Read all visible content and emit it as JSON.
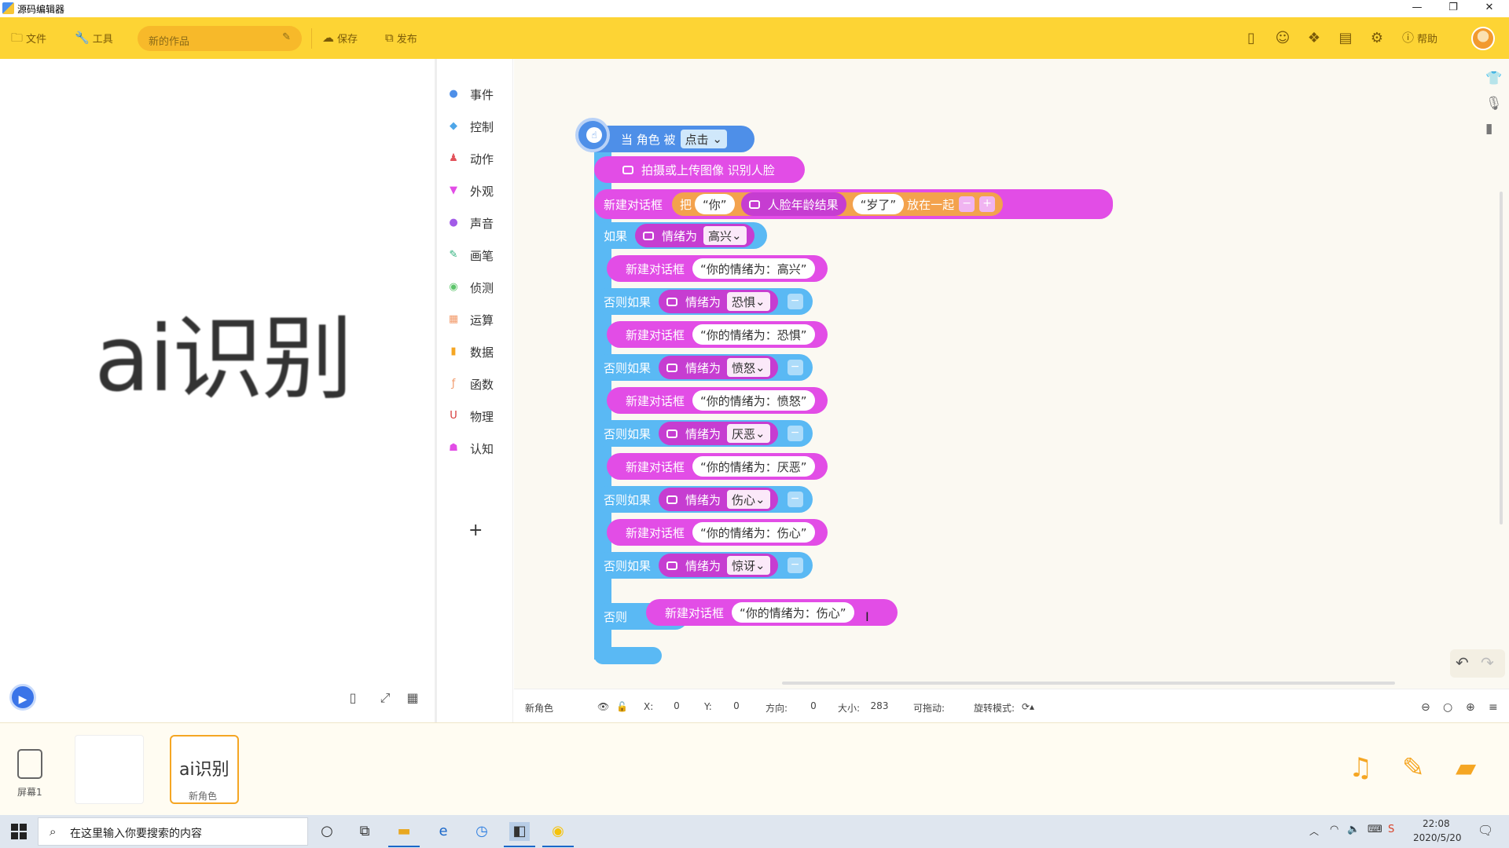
{
  "window": {
    "title": "源码编辑器",
    "controls": [
      "—",
      "❐",
      "✕"
    ]
  },
  "toolbar": {
    "file": "文件",
    "tools": "工具",
    "project_name": "新的作品",
    "save": "保存",
    "publish": "发布",
    "help": "帮助",
    "right_icons": [
      "tablet-icon",
      "robot-icon",
      "group-icon",
      "calendar-icon",
      "settings-icon"
    ]
  },
  "stage": {
    "sprite_text": "ai识别"
  },
  "categories": [
    {
      "label": "事件",
      "color": "#4e8fe8",
      "glyph": "●"
    },
    {
      "label": "控制",
      "color": "#4ea6e8",
      "glyph": "◆"
    },
    {
      "label": "动作",
      "color": "#e2525a",
      "glyph": "♟"
    },
    {
      "label": "外观",
      "color": "#e24de6",
      "glyph": "▼"
    },
    {
      "label": "声音",
      "color": "#a25be8",
      "glyph": "●"
    },
    {
      "label": "画笔",
      "color": "#2bb07a",
      "glyph": "✎"
    },
    {
      "label": "侦测",
      "color": "#5cc46a",
      "glyph": "◉"
    },
    {
      "label": "运算",
      "color": "#f29a6a",
      "glyph": "▦"
    },
    {
      "label": "数据",
      "color": "#f5a623",
      "glyph": "▮"
    },
    {
      "label": "函数",
      "color": "#f29a6a",
      "glyph": "ƒ"
    },
    {
      "label": "物理",
      "color": "#d63a3a",
      "glyph": "U"
    },
    {
      "label": "认知",
      "color": "#e24de6",
      "glyph": "☗"
    }
  ],
  "add_category": "+",
  "blocks": {
    "hat": {
      "prefix": "当 角色 被",
      "option": "点击"
    },
    "capture": "拍摄或上传图像 识别人脸",
    "dialog_join": {
      "label": "新建对话框",
      "join_prefix": "把",
      "str1": "“你”",
      "age": "人脸年龄结果",
      "str2": "“岁了”",
      "join_suffix": "放在一起"
    },
    "if_label": "如果",
    "elseif_label": "否则如果",
    "else_label": "否则",
    "emotion_label": "情绪为",
    "new_dialog": "新建对话框",
    "branches": [
      {
        "emotion": "高兴",
        "text": "“你的情绪为：高兴”"
      },
      {
        "emotion": "恐惧",
        "text": "“你的情绪为：恐惧”"
      },
      {
        "emotion": "愤怒",
        "text": "“你的情绪为：愤怒”"
      },
      {
        "emotion": "厌恶",
        "text": "“你的情绪为：厌恶”"
      },
      {
        "emotion": "伤心",
        "text": "“你的情绪为：伤心”"
      },
      {
        "emotion": "惊讶",
        "text": "“你的情绪为：伤心”"
      }
    ]
  },
  "propbar": {
    "name": "新角色",
    "x_label": "X:",
    "x": "0",
    "y_label": "Y:",
    "y": "0",
    "dir_label": "方向:",
    "dir": "0",
    "size_label": "大小:",
    "size": "283",
    "drag_label": "可拖动:",
    "rot_label": "旋转模式:"
  },
  "bottom": {
    "screen": "屏幕1",
    "sprite_thumb": "ai识别",
    "sprite_name": "新角色"
  },
  "taskbar": {
    "search_placeholder": "在这里输入你要搜索的内容",
    "time": "22:08",
    "date": "2020/5/20"
  }
}
